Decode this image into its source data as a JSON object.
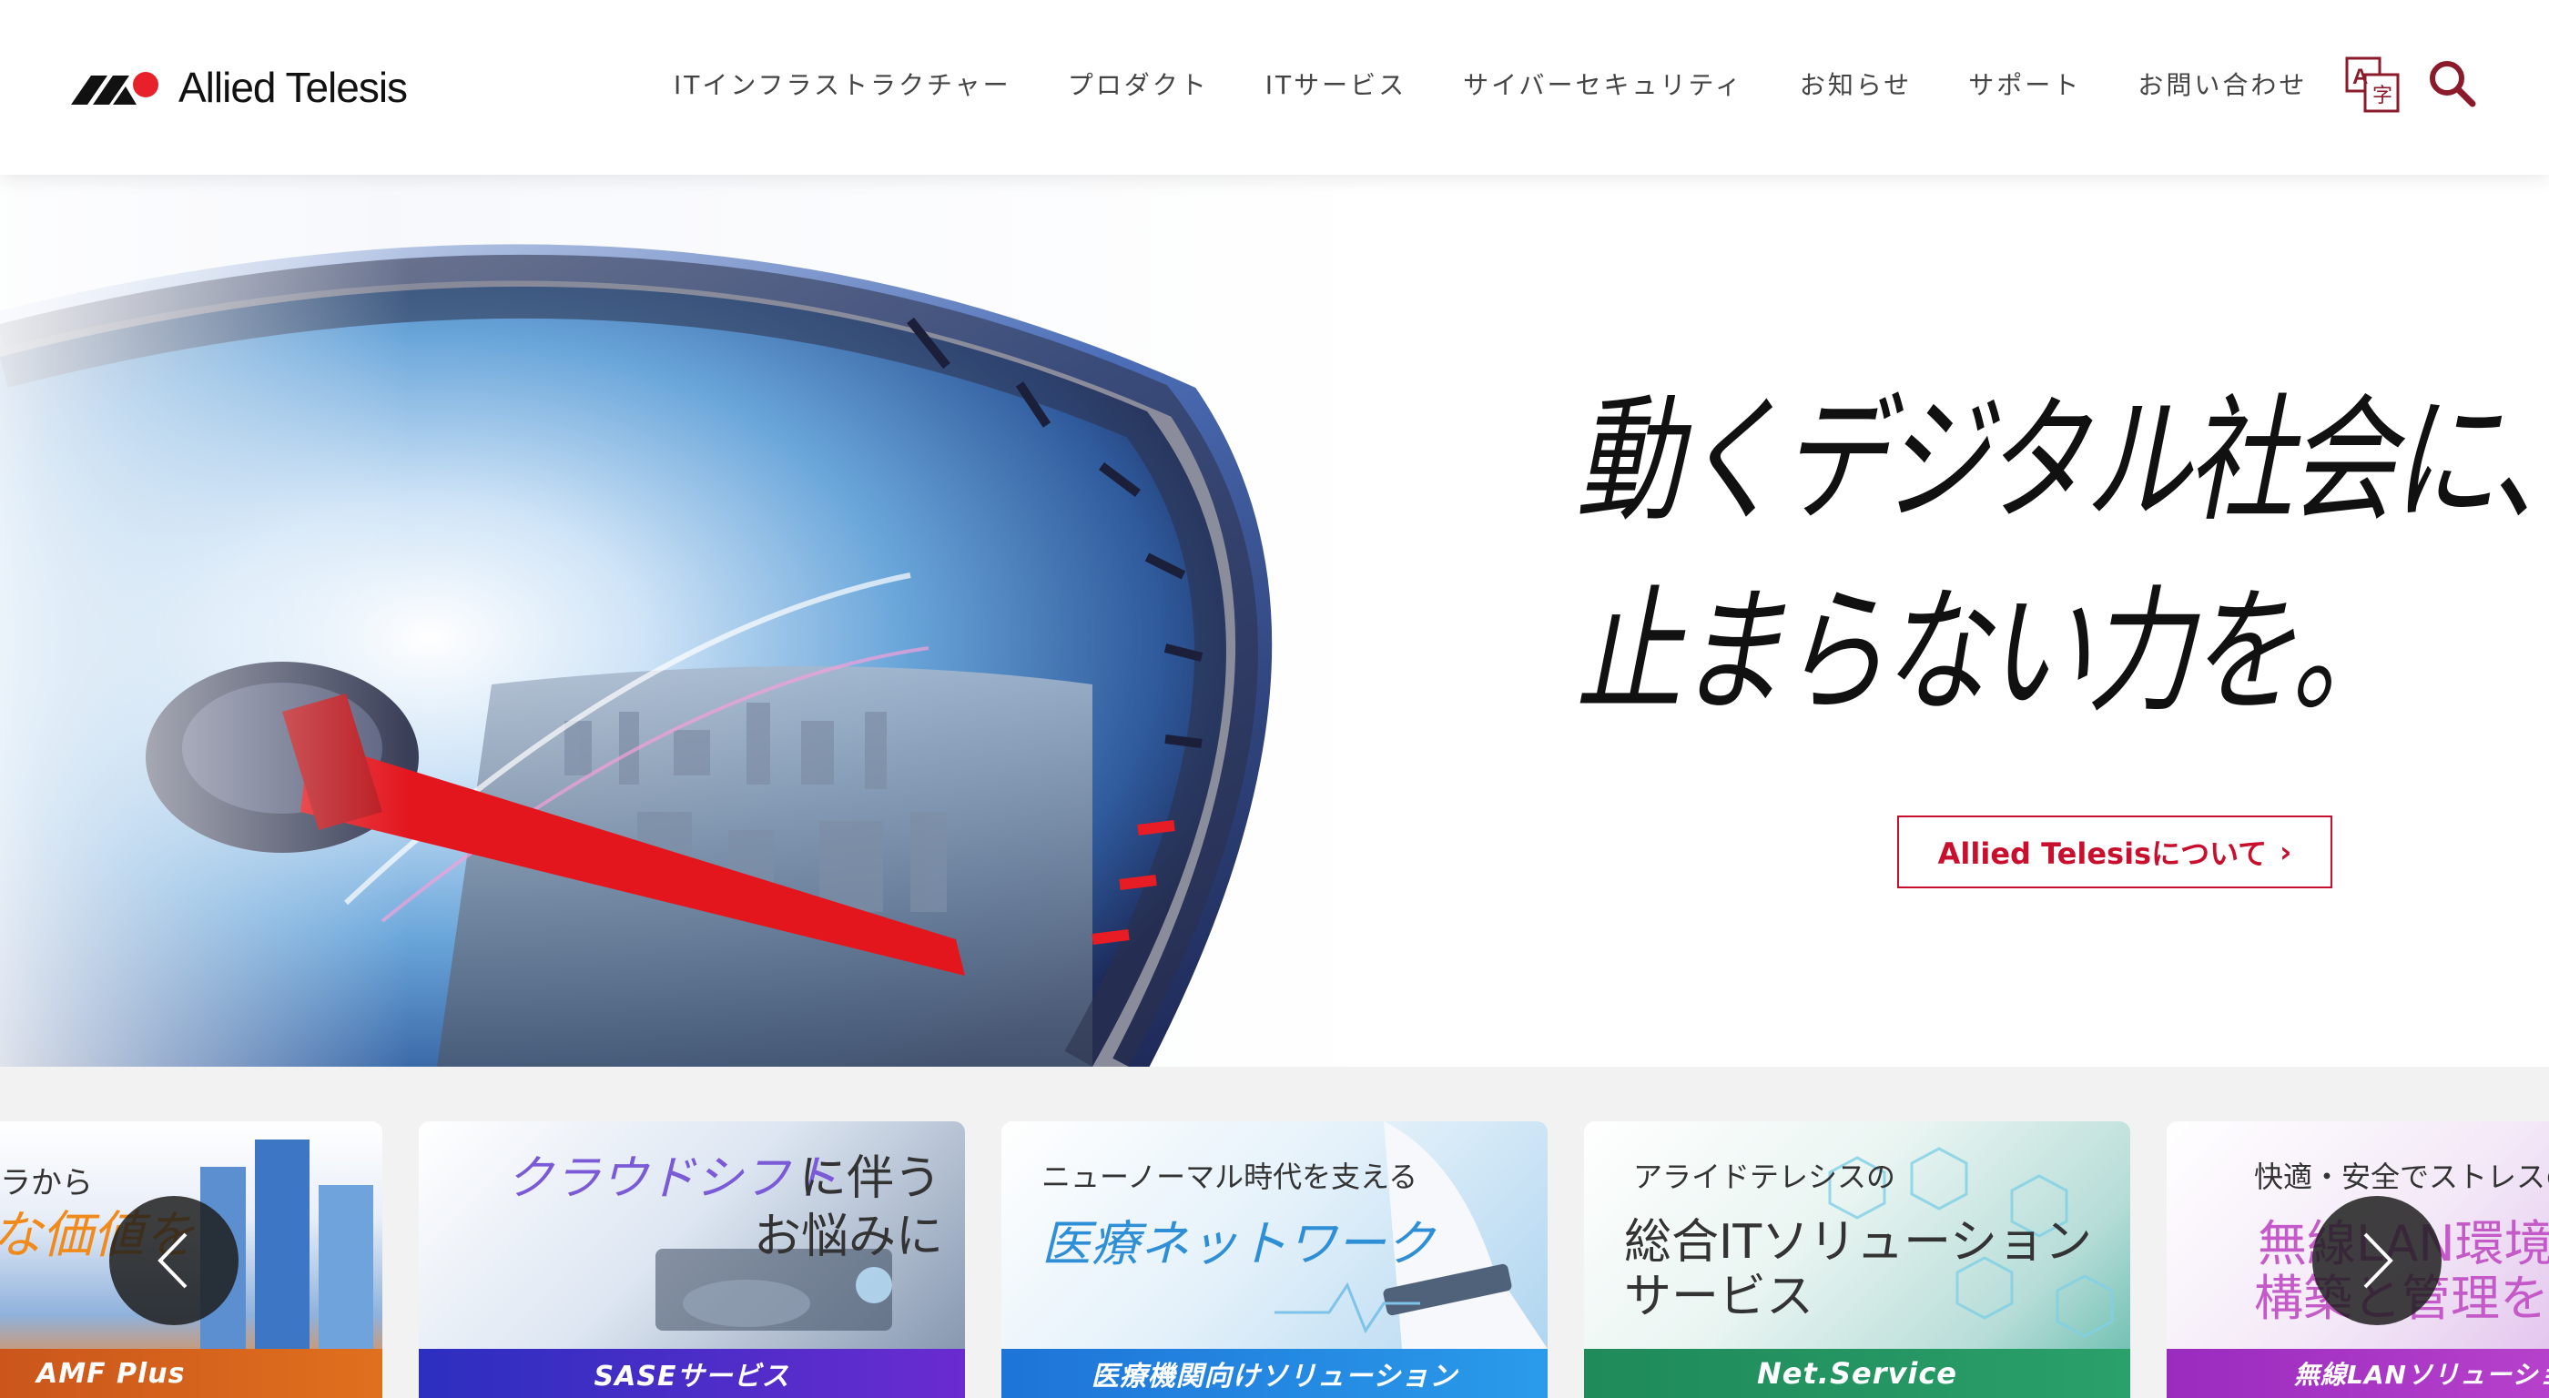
{
  "header": {
    "logo_text": "Allied Telesis",
    "nav": [
      "ITインフラストラクチャー",
      "プロダクト",
      "ITサービス",
      "サイバーセキュリティ",
      "お知らせ",
      "サポート",
      "お問い合わせ"
    ]
  },
  "hero": {
    "headline_line1": "動くデジタル社会に、",
    "headline_line2": "止まらない力を。",
    "button_label": "Allied Telesisについて",
    "button_chevron": "›"
  },
  "carousel": {
    "cards": [
      {
        "line1": "ラから",
        "line2": "な価値を",
        "caption": "AMF Plus"
      },
      {
        "line1": "に伴う",
        "line1_accent": "クラウドシフト",
        "line2": "お悩みに",
        "caption": "SASEサービス"
      },
      {
        "line1": "ニューノーマル時代を支える",
        "line2": "医療ネットワーク",
        "caption": "医療機関向けソリューション"
      },
      {
        "line1": "アライドテレシスの",
        "line2": "総合ITソリューション",
        "line3": "サービス",
        "caption": "Net.Service"
      },
      {
        "line1": "快適・安全でストレスの",
        "line2": "無線LAN環境",
        "line3": "構築と管理を実",
        "caption": "無線LANソリューション"
      }
    ]
  },
  "colors": {
    "brand_red": "#c8102e",
    "text_dark": "#111111",
    "nav_text": "#444444",
    "icon_maroon": "#8b1a2b"
  },
  "icons": [
    "translate-icon",
    "search-icon",
    "chevron-left-icon",
    "chevron-right-icon"
  ]
}
